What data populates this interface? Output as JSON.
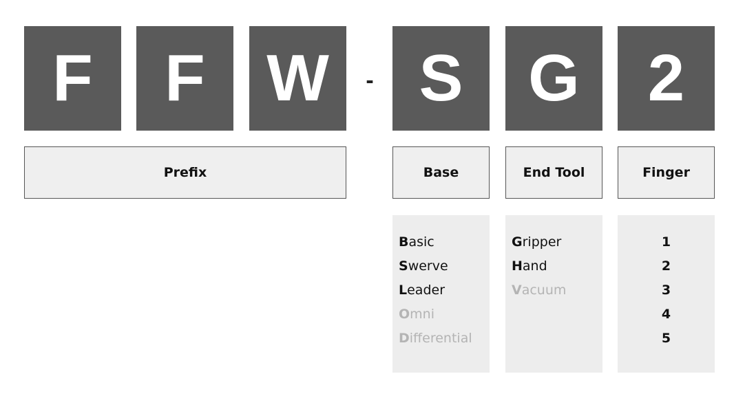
{
  "code_letters": [
    {
      "label": "F"
    },
    {
      "label": "F"
    },
    {
      "label": "W"
    },
    {
      "label": "S"
    },
    {
      "label": "G"
    },
    {
      "label": "2"
    }
  ],
  "separator": "-",
  "segments": {
    "prefix": "Prefix",
    "base": "Base",
    "end_tool": "End Tool",
    "finger": "Finger"
  },
  "base_options": [
    {
      "initial": "B",
      "rest": "asic",
      "active": true
    },
    {
      "initial": "S",
      "rest": "werve",
      "active": true
    },
    {
      "initial": "L",
      "rest": "eader",
      "active": true
    },
    {
      "initial": "O",
      "rest": "mni",
      "active": false
    },
    {
      "initial": "D",
      "rest": "ifferential",
      "active": false
    }
  ],
  "end_tool_options": [
    {
      "initial": "G",
      "rest": "ripper",
      "active": true
    },
    {
      "initial": "H",
      "rest": "and",
      "active": true
    },
    {
      "initial": "V",
      "rest": "acuum",
      "active": false
    }
  ],
  "finger_options": [
    "1",
    "2",
    "3",
    "4",
    "5"
  ],
  "colors": {
    "letter_box": "#5a5a5a",
    "label_box": "#efefef",
    "options_box": "#ededed",
    "inactive_text": "#b4b4b4"
  }
}
